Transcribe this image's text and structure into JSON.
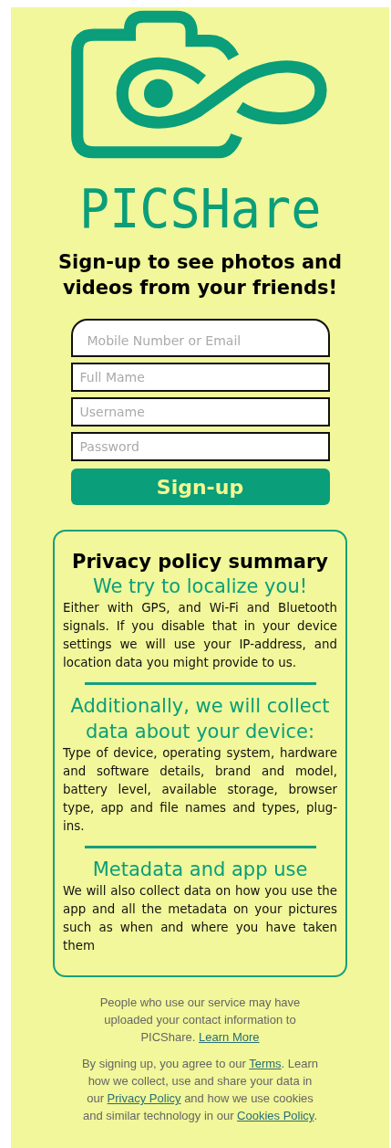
{
  "logo": {
    "wordmark": "PICSHare"
  },
  "headline": "Sign-up to see photos and videos from your friends!",
  "fields": [
    {
      "kind": "rounded",
      "placeholder": "Mobile Number or Email"
    },
    {
      "kind": "plain",
      "placeholder": "Full Mame"
    },
    {
      "kind": "plain",
      "placeholder": "Username"
    },
    {
      "kind": "plain",
      "placeholder": "Password"
    }
  ],
  "signup_button": "Sign-up",
  "privacy": {
    "title": "Privacy policy summary",
    "sections": [
      {
        "heading": "We try to localize you!",
        "body": "Either with GPS, and Wi-Fi and Bluetooth signals. If you disable that in your device settings we will use your IP-address, and location data you might provide to us."
      },
      {
        "heading": "Additionally, we will collect data about your device:",
        "body": "Type of device, operating system, hardware and software details, brand and model, battery level, available storage, browser type, app and file names and types, plug-ins."
      },
      {
        "heading": "Metadata and app use",
        "body": "We will also collect data on how you use the app and all the metadata on your pictures such as when and where you have taken them"
      }
    ]
  },
  "footer": [
    [
      {
        "kind": "text",
        "text": "People who use our service may have uploaded your contact information to PICShare. "
      },
      {
        "kind": "link",
        "text": "Learn More"
      }
    ],
    [
      {
        "kind": "text",
        "text": "By signing up, you agree to our "
      },
      {
        "kind": "link",
        "text": "Terms"
      },
      {
        "kind": "text",
        "text": ". Learn how we collect, use and share your data in our "
      },
      {
        "kind": "link",
        "text": "Privacy Policy"
      },
      {
        "kind": "text",
        "text": " and how we use cookies and similar technology in our "
      },
      {
        "kind": "link",
        "text": "Cookies Policy"
      },
      {
        "kind": "text",
        "text": "."
      }
    ]
  ]
}
